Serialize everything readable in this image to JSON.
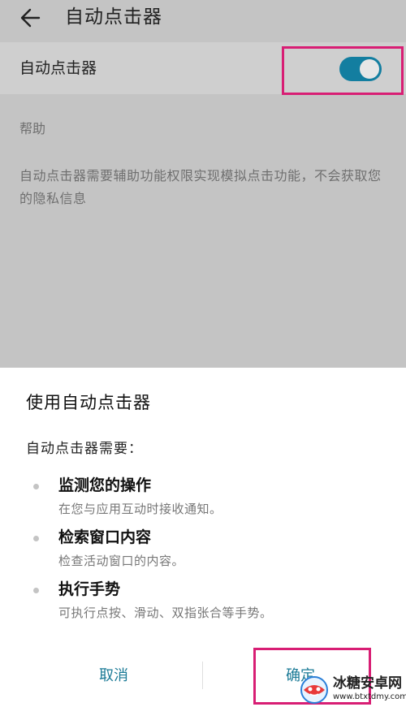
{
  "app_bar": {
    "title": "自动点击器"
  },
  "setting": {
    "switch_label": "自动点击器",
    "switch_on": true,
    "accent_color": "#137ea0"
  },
  "help": {
    "header": "帮助",
    "text": "自动点击器需要辅助功能权限实现模拟点击功能，不会获取您的隐私信息"
  },
  "dialog": {
    "title": "使用自动点击器",
    "intro": "自动点击器需要：",
    "permissions": [
      {
        "title": "监测您的操作",
        "desc": "在您与应用互动时接收通知。"
      },
      {
        "title": "检索窗口内容",
        "desc": "检查活动窗口的内容。"
      },
      {
        "title": "执行手势",
        "desc": "可执行点按、滑动、双指张合等手势。"
      }
    ],
    "cancel_label": "取消",
    "confirm_label": "确定",
    "button_color": "#1a7a96"
  },
  "annotations": {
    "highlight_color": "#d81e74"
  },
  "watermark": {
    "name": "冰糖安卓网",
    "url": "www.btxtdmy.com"
  }
}
